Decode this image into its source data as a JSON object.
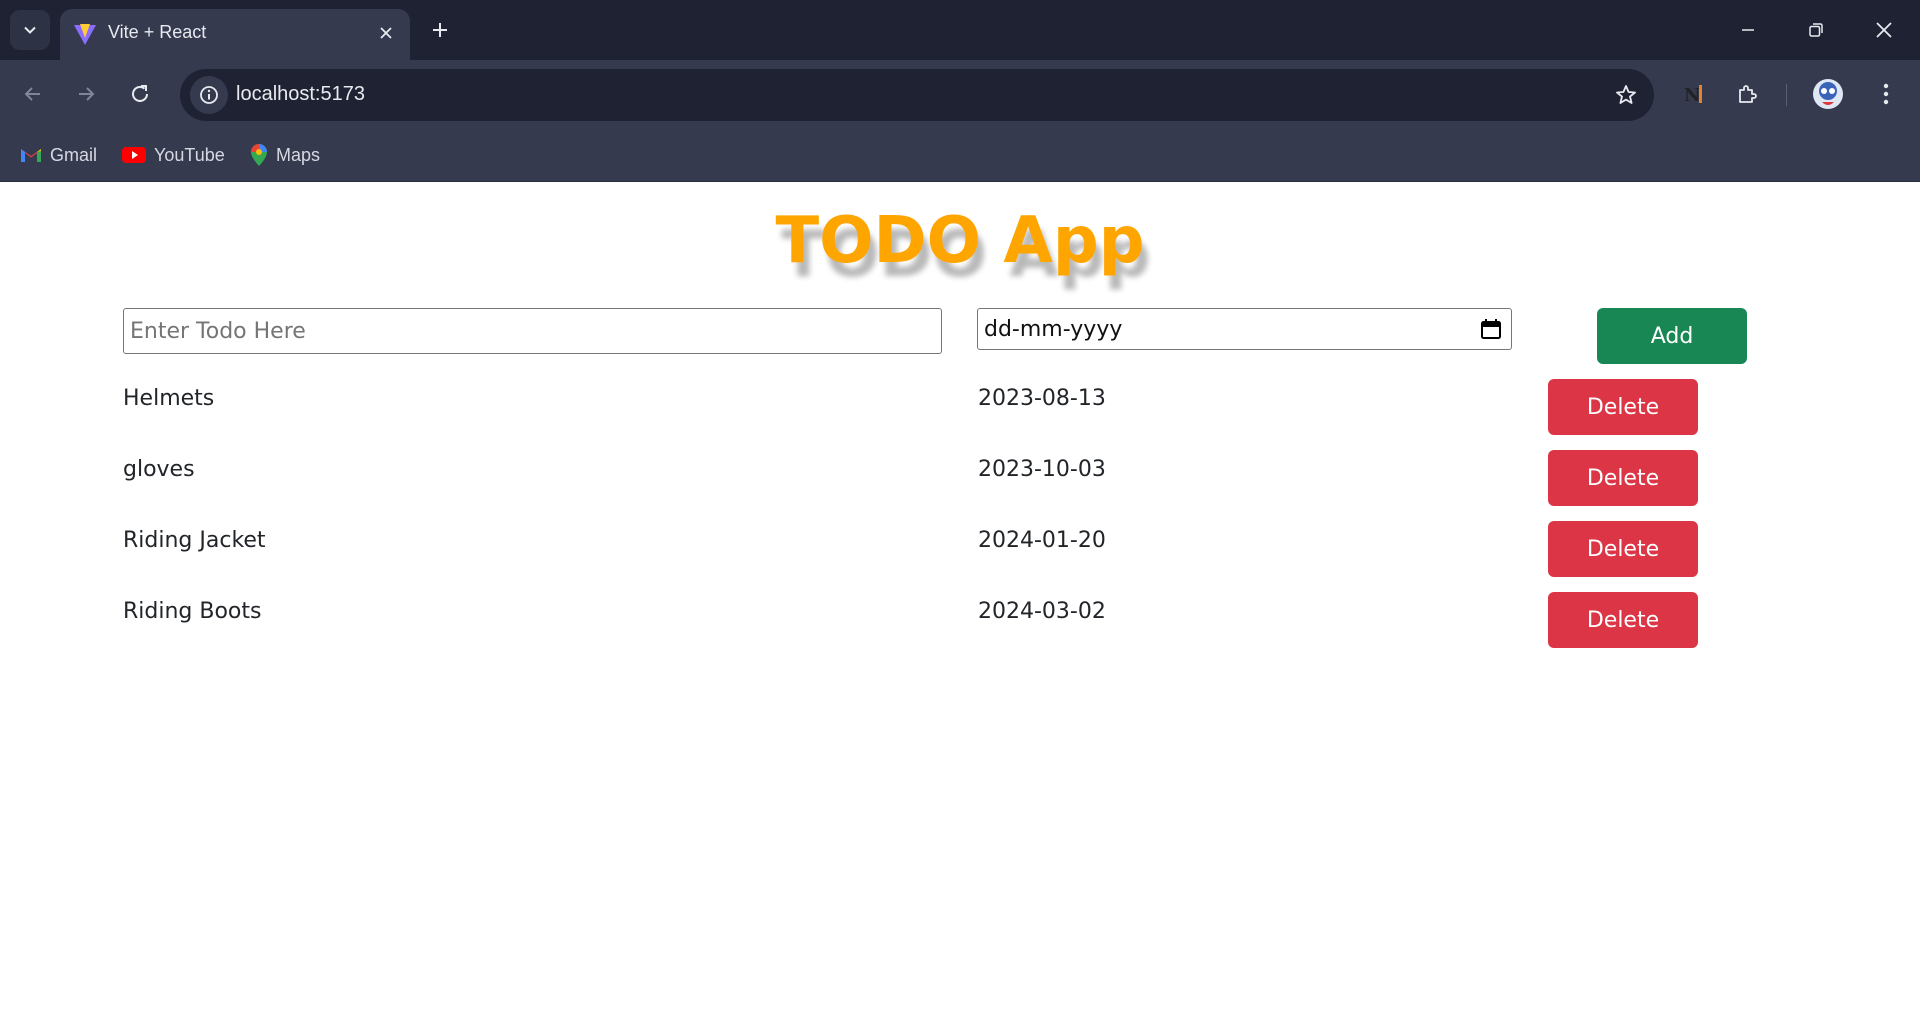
{
  "browser": {
    "tab_title": "Vite + React",
    "url": "localhost:5173",
    "bookmarks": [
      {
        "label": "Gmail",
        "icon": "gmail-icon"
      },
      {
        "label": "YouTube",
        "icon": "youtube-icon"
      },
      {
        "label": "Maps",
        "icon": "maps-icon"
      }
    ]
  },
  "app": {
    "title": "TODO App",
    "todo_input": {
      "placeholder": "Enter Todo Here",
      "value": ""
    },
    "date_input": {
      "display": "dd-mm-yyyy"
    },
    "add_label": "Add",
    "delete_label": "Delete",
    "items": [
      {
        "name": "Helmets",
        "date": "2023-08-13"
      },
      {
        "name": "gloves",
        "date": "2023-10-03"
      },
      {
        "name": "Riding Jacket",
        "date": "2024-01-20"
      },
      {
        "name": "Riding Boots",
        "date": "2024-03-02"
      }
    ]
  },
  "colors": {
    "title": "#ffa500",
    "add_button": "#198754",
    "delete_button": "#dc3545",
    "chrome_dark": "#1f2233",
    "chrome_mid": "#353a4f"
  }
}
